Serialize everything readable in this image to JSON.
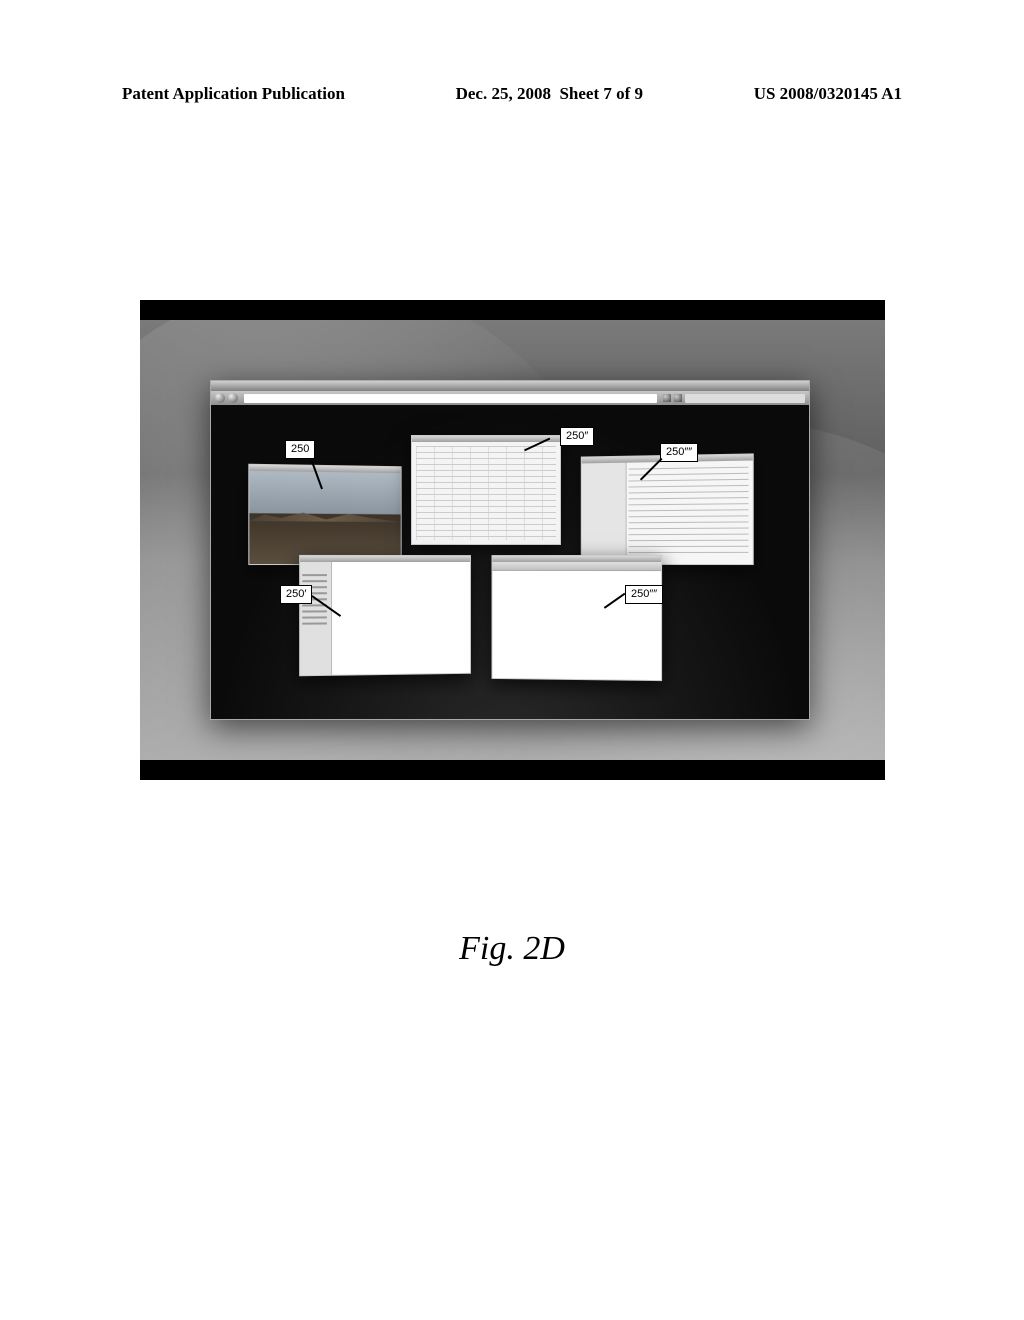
{
  "header": {
    "left": "Patent Application Publication",
    "mid": "Dec. 25, 2008  Sheet 7 of 9",
    "right": "US 2008/0320145 A1"
  },
  "figure": {
    "label": "Fig. 2D",
    "refs": {
      "r1": "250",
      "r2": "250″",
      "r3": "250″″",
      "r4": "250′",
      "r5": "250″″"
    }
  }
}
